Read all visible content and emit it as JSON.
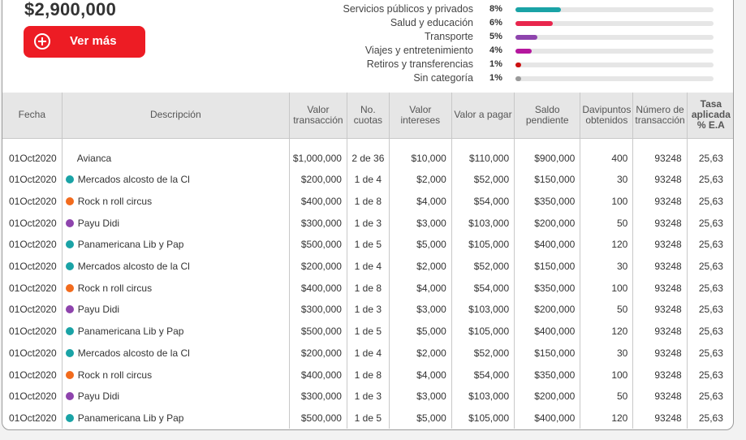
{
  "summary": {
    "total": "$2,900,000",
    "ver_mas_label": "Ver más"
  },
  "categories": [
    {
      "name": "Servicios públicos y privados",
      "pct": "8%",
      "value": 0.23,
      "color": "#1aa3a6"
    },
    {
      "name": "Salud y educación",
      "pct": "6%",
      "value": 0.19,
      "color": "#e8264d"
    },
    {
      "name": "Transporte",
      "pct": "5%",
      "value": 0.11,
      "color": "#8e44ad"
    },
    {
      "name": "Viajes y entretenimiento",
      "pct": "4%",
      "value": 0.08,
      "color": "#b5179e"
    },
    {
      "name": "Retiros y transferencias",
      "pct": "1%",
      "value": 0.03,
      "color": "#cc1010"
    },
    {
      "name": "Sin categoría",
      "pct": "1%",
      "value": 0.03,
      "color": "#9a9a9a"
    }
  ],
  "table": {
    "headers": [
      "Fecha",
      "Descripción",
      "Valor transacción",
      "No. cuotas",
      "Valor intereses",
      "Valor a pagar",
      "Saldo pendiente",
      "Davipuntos obtenidos",
      "Número de transacción",
      "Tasa aplicada % E.A"
    ],
    "category_colors": {
      "teal": "#1aa3a6",
      "orange": "#f26b1d",
      "purple": "#8e44ad",
      "none": ""
    },
    "rows": [
      {
        "fecha": "01Oct2020",
        "dot": "none",
        "desc": "Avianca",
        "valor": "$1,000,000",
        "cuotas": "2 de 36",
        "intereses": "$10,000",
        "pagar": "$110,000",
        "saldo": "$900,000",
        "puntos": "400",
        "num": "93248",
        "tasa": "25,63"
      },
      {
        "fecha": "01Oct2020",
        "dot": "teal",
        "desc": "Mercados alcosto de la Cl",
        "valor": "$200,000",
        "cuotas": "1 de 4",
        "intereses": "$2,000",
        "pagar": "$52,000",
        "saldo": "$150,000",
        "puntos": "30",
        "num": "93248",
        "tasa": "25,63"
      },
      {
        "fecha": "01Oct2020",
        "dot": "orange",
        "desc": "Rock n roll circus",
        "valor": "$400,000",
        "cuotas": "1 de 8",
        "intereses": "$4,000",
        "pagar": "$54,000",
        "saldo": "$350,000",
        "puntos": "100",
        "num": "93248",
        "tasa": "25,63"
      },
      {
        "fecha": "01Oct2020",
        "dot": "purple",
        "desc": "Payu Didi",
        "valor": "$300,000",
        "cuotas": "1 de 3",
        "intereses": "$3,000",
        "pagar": "$103,000",
        "saldo": "$200,000",
        "puntos": "50",
        "num": "93248",
        "tasa": "25,63"
      },
      {
        "fecha": "01Oct2020",
        "dot": "teal",
        "desc": "Panamericana Lib y Pap",
        "valor": "$500,000",
        "cuotas": "1 de 5",
        "intereses": "$5,000",
        "pagar": "$105,000",
        "saldo": "$400,000",
        "puntos": "120",
        "num": "93248",
        "tasa": "25,63"
      },
      {
        "fecha": "01Oct2020",
        "dot": "teal",
        "desc": "Mercados alcosto de la Cl",
        "valor": "$200,000",
        "cuotas": "1 de 4",
        "intereses": "$2,000",
        "pagar": "$52,000",
        "saldo": "$150,000",
        "puntos": "30",
        "num": "93248",
        "tasa": "25,63"
      },
      {
        "fecha": "01Oct2020",
        "dot": "orange",
        "desc": "Rock n roll circus",
        "valor": "$400,000",
        "cuotas": "1 de 8",
        "intereses": "$4,000",
        "pagar": "$54,000",
        "saldo": "$350,000",
        "puntos": "100",
        "num": "93248",
        "tasa": "25,63"
      },
      {
        "fecha": "01Oct2020",
        "dot": "purple",
        "desc": "Payu Didi",
        "valor": "$300,000",
        "cuotas": "1 de 3",
        "intereses": "$3,000",
        "pagar": "$103,000",
        "saldo": "$200,000",
        "puntos": "50",
        "num": "93248",
        "tasa": "25,63"
      },
      {
        "fecha": "01Oct2020",
        "dot": "teal",
        "desc": "Panamericana Lib y Pap",
        "valor": "$500,000",
        "cuotas": "1 de 5",
        "intereses": "$5,000",
        "pagar": "$105,000",
        "saldo": "$400,000",
        "puntos": "120",
        "num": "93248",
        "tasa": "25,63"
      },
      {
        "fecha": "01Oct2020",
        "dot": "teal",
        "desc": "Mercados alcosto de la Cl",
        "valor": "$200,000",
        "cuotas": "1 de 4",
        "intereses": "$2,000",
        "pagar": "$52,000",
        "saldo": "$150,000",
        "puntos": "30",
        "num": "93248",
        "tasa": "25,63"
      },
      {
        "fecha": "01Oct2020",
        "dot": "orange",
        "desc": "Rock n roll circus",
        "valor": "$400,000",
        "cuotas": "1 de 8",
        "intereses": "$4,000",
        "pagar": "$54,000",
        "saldo": "$350,000",
        "puntos": "100",
        "num": "93248",
        "tasa": "25,63"
      },
      {
        "fecha": "01Oct2020",
        "dot": "purple",
        "desc": "Payu Didi",
        "valor": "$300,000",
        "cuotas": "1 de 3",
        "intereses": "$3,000",
        "pagar": "$103,000",
        "saldo": "$200,000",
        "puntos": "50",
        "num": "93248",
        "tasa": "25,63"
      },
      {
        "fecha": "01Oct2020",
        "dot": "teal",
        "desc": "Panamericana Lib y Pap",
        "valor": "$500,000",
        "cuotas": "1 de 5",
        "intereses": "$5,000",
        "pagar": "$105,000",
        "saldo": "$400,000",
        "puntos": "120",
        "num": "93248",
        "tasa": "25,63"
      }
    ]
  }
}
